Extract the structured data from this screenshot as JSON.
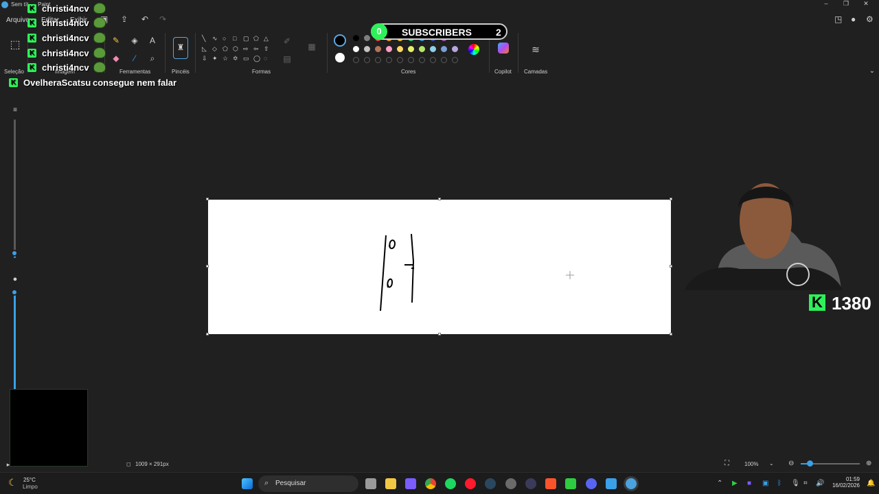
{
  "window": {
    "title": "Sem tít... - Paint"
  },
  "menu": {
    "file": "Arquivo",
    "edit": "Editar",
    "view": "Exibir"
  },
  "ribbon": {
    "groups": {
      "selection": "Seleção",
      "image": "Imagem",
      "tools": "Ferramentas",
      "brushes": "Pincéis",
      "shapes": "Formas",
      "colors": "Cores",
      "copilot": "Copilot",
      "layers": "Camadas"
    },
    "palette_row1": [
      "#000000",
      "#7f7f7f",
      "#e74c3c",
      "#f39c12",
      "#f1c40f",
      "#2ecc71",
      "#3498db",
      "#3f51b5",
      "#9b59b6"
    ],
    "palette_row2": [
      "#ffffff",
      "#c3c3c3",
      "#b5735a",
      "#ff9ec7",
      "#ffd866",
      "#e5f06a",
      "#b6e66a",
      "#8fd0ea",
      "#7a9fd6",
      "#b8a4e0"
    ]
  },
  "chat": {
    "messages": [
      {
        "user": "christi4ncv",
        "text": ""
      },
      {
        "user": "christi4ncv",
        "text": ""
      },
      {
        "user": "christi4ncv",
        "text": ""
      },
      {
        "user": "christi4ncv",
        "text": ""
      },
      {
        "user": "christi4ncv",
        "text": ""
      },
      {
        "user": "OvelheraScatsu",
        "text": "consegue nem falar"
      }
    ],
    "kick_letter": "K"
  },
  "subscribers": {
    "count": "0",
    "label": "SUBSCRIBERS",
    "goal": "2"
  },
  "kick_counter": {
    "letter": "K",
    "value": "1380"
  },
  "status": {
    "dimensions": "1009 × 291px",
    "zoom": "100%"
  },
  "taskbar": {
    "search_placeholder": "Pesquisar",
    "weather_temp": "25°C",
    "weather_desc": "Limpo",
    "time": "01:59",
    "date": "16/02/2026"
  },
  "colors": {
    "accent": "#3aa0e8",
    "kick_green": "#2ff05a"
  }
}
